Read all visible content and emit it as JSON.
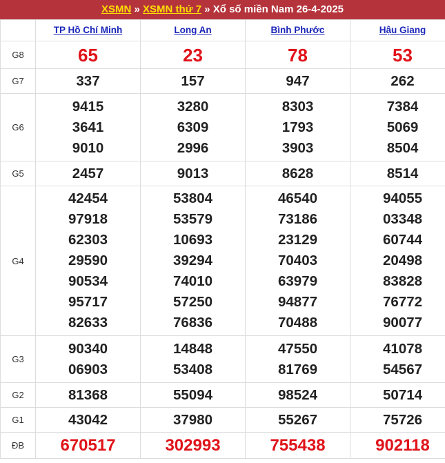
{
  "header": {
    "link1": "XSMN",
    "sep1": " » ",
    "link2": "XSMN thứ 7",
    "sep2": " » ",
    "title": "Xổ số miền Nam 26-4-2025"
  },
  "provinces": [
    "TP Hồ Chí Minh",
    "Long An",
    "Bình Phước",
    "Hậu Giang"
  ],
  "prizes": [
    {
      "label": "G8",
      "values": [
        [
          "65"
        ],
        [
          "23"
        ],
        [
          "78"
        ],
        [
          "53"
        ]
      ]
    },
    {
      "label": "G7",
      "values": [
        [
          "337"
        ],
        [
          "157"
        ],
        [
          "947"
        ],
        [
          "262"
        ]
      ]
    },
    {
      "label": "G6",
      "values": [
        [
          "9415",
          "3641",
          "9010"
        ],
        [
          "3280",
          "6309",
          "2996"
        ],
        [
          "8303",
          "1793",
          "3903"
        ],
        [
          "7384",
          "5069",
          "8504"
        ]
      ]
    },
    {
      "label": "G5",
      "values": [
        [
          "2457"
        ],
        [
          "9013"
        ],
        [
          "8628"
        ],
        [
          "8514"
        ]
      ]
    },
    {
      "label": "G4",
      "values": [
        [
          "42454",
          "97918",
          "62303",
          "29590",
          "90534",
          "95717",
          "82633"
        ],
        [
          "53804",
          "53579",
          "10693",
          "39294",
          "74010",
          "57250",
          "76836"
        ],
        [
          "46540",
          "73186",
          "23129",
          "70403",
          "63979",
          "94877",
          "70488"
        ],
        [
          "94055",
          "03348",
          "60744",
          "20498",
          "83828",
          "76772",
          "90077"
        ]
      ]
    },
    {
      "label": "G3",
      "values": [
        [
          "90340",
          "06903"
        ],
        [
          "14848",
          "53408"
        ],
        [
          "47550",
          "81769"
        ],
        [
          "41078",
          "54567"
        ]
      ]
    },
    {
      "label": "G2",
      "values": [
        [
          "81368"
        ],
        [
          "55094"
        ],
        [
          "98524"
        ],
        [
          "50714"
        ]
      ]
    },
    {
      "label": "G1",
      "values": [
        [
          "43042"
        ],
        [
          "37980"
        ],
        [
          "55267"
        ],
        [
          "75726"
        ]
      ]
    },
    {
      "label": "ĐB",
      "values": [
        [
          "670517"
        ],
        [
          "302993"
        ],
        [
          "755438"
        ],
        [
          "902118"
        ]
      ]
    }
  ]
}
